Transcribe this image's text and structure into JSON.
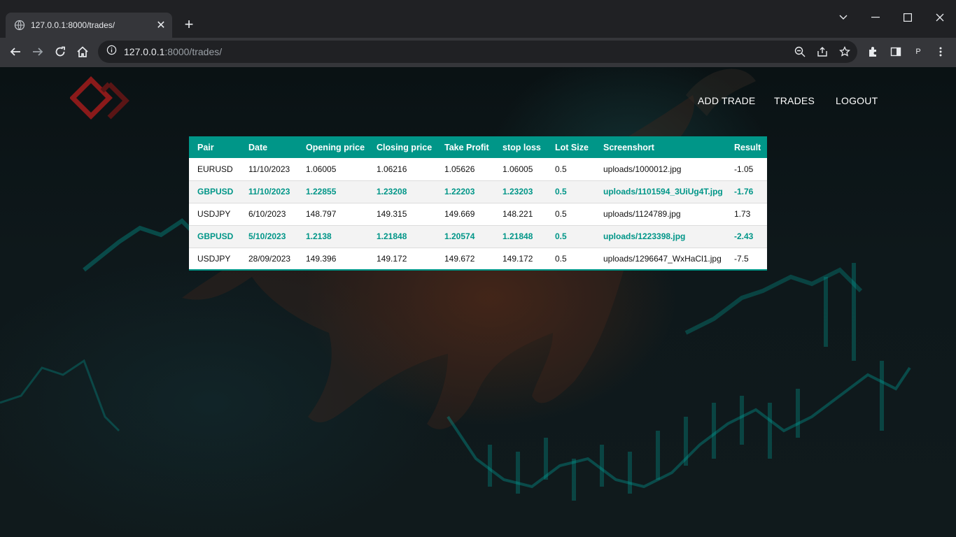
{
  "browser": {
    "tab_title": "127.0.0.1:8000/trades/",
    "url_host": "127.0.0.1",
    "url_rest": ":8000/trades/",
    "profile_initial": "P"
  },
  "nav": {
    "add_trade": "ADD TRADE",
    "trades": "TRADES",
    "logout": "LOGOUT"
  },
  "colors": {
    "accent": "#009688",
    "logo": "#8b1a1a"
  },
  "table": {
    "headers": [
      "Pair",
      "Date",
      "Opening price",
      "Closing price",
      "Take Profit",
      "stop loss",
      "Lot Size",
      "Screenshort",
      "Result"
    ],
    "rows": [
      [
        "EURUSD",
        "11/10/2023",
        "1.06005",
        "1.06216",
        "1.05626",
        "1.06005",
        "0.5",
        "uploads/1000012.jpg",
        "-1.05"
      ],
      [
        "GBPUSD",
        "11/10/2023",
        "1.22855",
        "1.23208",
        "1.22203",
        "1.23203",
        "0.5",
        "uploads/1101594_3UiUg4T.jpg",
        "-1.76"
      ],
      [
        "USDJPY",
        "6/10/2023",
        "148.797",
        "149.315",
        "149.669",
        "148.221",
        "0.5",
        "uploads/1124789.jpg",
        "1.73"
      ],
      [
        "GBPUSD",
        "5/10/2023",
        "1.2138",
        "1.21848",
        "1.20574",
        "1.21848",
        "0.5",
        "uploads/1223398.jpg",
        "-2.43"
      ],
      [
        "USDJPY",
        "28/09/2023",
        "149.396",
        "149.172",
        "149.672",
        "149.172",
        "0.5",
        "uploads/1296647_WxHaCl1.jpg",
        "-7.5"
      ]
    ]
  }
}
